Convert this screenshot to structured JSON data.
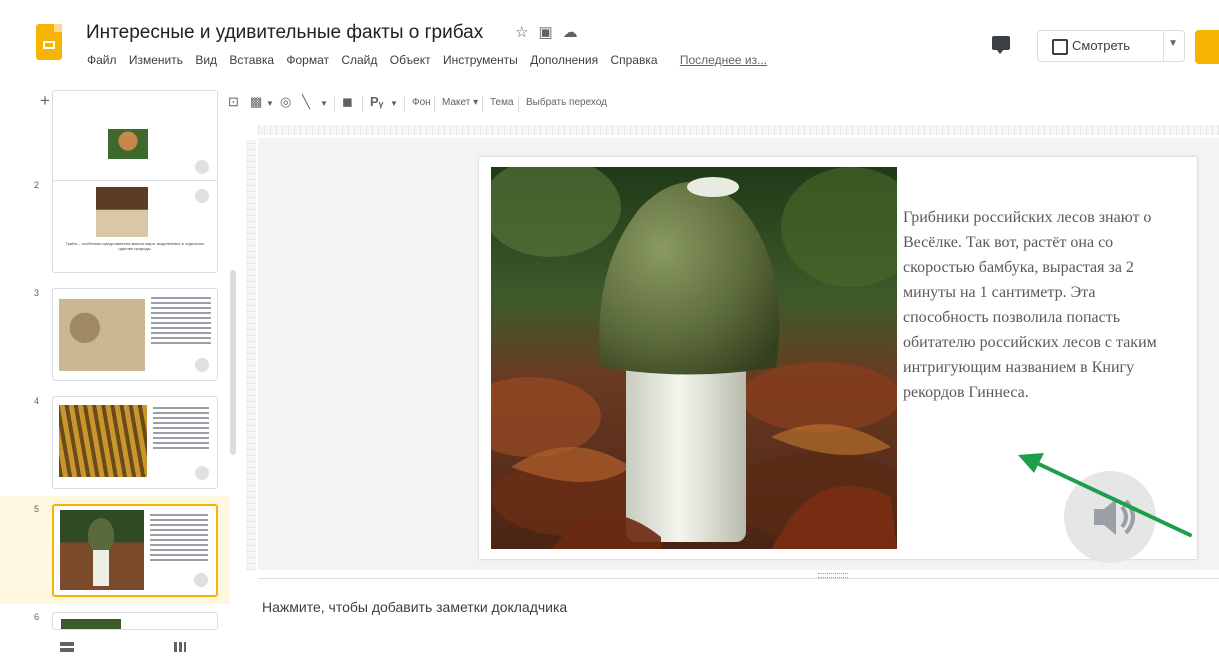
{
  "header": {
    "title": "Интересные и удивительные факты о грибах",
    "menu": [
      "Файл",
      "Изменить",
      "Вид",
      "Вставка",
      "Формат",
      "Слайд",
      "Объект",
      "Инструменты",
      "Дополнения",
      "Справка"
    ],
    "last_edit": "Последнее из...",
    "present_label": "Смотреть"
  },
  "toolbar": {
    "background_label": "Фон",
    "layout_label": "Макет ▾",
    "theme_label": "Тема",
    "transition_label": "Выбрать переход"
  },
  "filmstrip": {
    "slides": [
      {
        "number": "2",
        "caption": "Грибы – особенная представители живого мира, выделенные в отдельное царство природы."
      },
      {
        "number": "3",
        "caption": ""
      },
      {
        "number": "4",
        "caption": ""
      },
      {
        "number": "5",
        "caption": "",
        "selected": true
      },
      {
        "number": "6",
        "caption": ""
      }
    ]
  },
  "slide": {
    "body_text": "Грибники российских лесов знают о Весёлке. Так вот, растёт она со скоростью бамбука, вырастая за 2 минуты на 1 сантиметр. Эта способность позволила попасть обитателю российских лесов с таким интригующим названием в Книгу рекордов Гиннеса."
  },
  "notes": {
    "placeholder": "Нажмите, чтобы добавить заметки докладчика"
  },
  "colors": {
    "accent": "#f4b400",
    "arrow": "#1e9e4a",
    "cap": "#5b6a3a",
    "stem": "#eef0e6"
  }
}
